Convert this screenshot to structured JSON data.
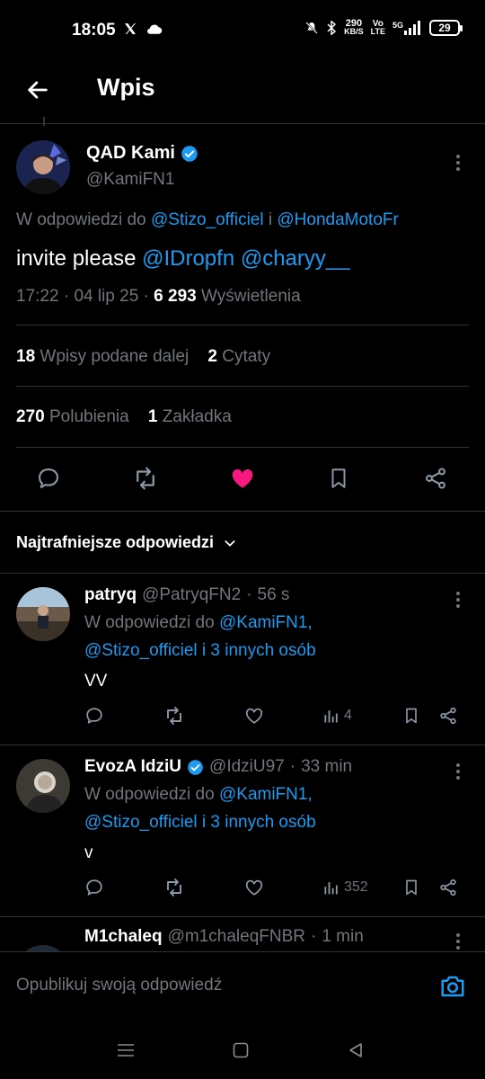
{
  "status_bar": {
    "time": "18:05",
    "net_speed_value": "290",
    "net_speed_unit": "KB/S",
    "volte_top": "Vo",
    "volte_bottom": "LTE",
    "network": "5G",
    "battery": "29"
  },
  "header": {
    "title": "Wpis"
  },
  "tweet": {
    "author_name": "QAD Kami",
    "author_handle": "@KamiFN1",
    "reply_prefix": "W odpowiedzi do",
    "reply_user_1": "@Stizo_officiel",
    "reply_and": "i",
    "reply_user_2": "@HondaMotoFr",
    "text_plain": "invite please",
    "mention_1": "@IDropfn",
    "mention_2": "@charyy__",
    "time": "17:22",
    "date": "04 lip 25",
    "views_count": "6 293",
    "views_label": "Wyświetlenia",
    "retweets_count": "18",
    "retweets_label": "Wpisy podane dalej",
    "quotes_count": "2",
    "quotes_label": "Cytaty",
    "likes_count": "270",
    "likes_label": "Polubienia",
    "bookmarks_count": "1",
    "bookmarks_label": "Zakładka",
    "liked": true,
    "like_color": "#f91880",
    "link_color": "#1d9bf0"
  },
  "sort": {
    "label": "Najtrafniejsze odpowiedzi"
  },
  "replies": [
    {
      "name": "patryq",
      "handle": "@PatryqFN2",
      "age": "56 s",
      "verified": false,
      "reply_prefix": "W odpowiedzi do",
      "reply_user": "@KamiFN1,",
      "reply_line2_user": "@Stizo_officiel",
      "reply_line2_rest": "i 3 innych osób",
      "text": "VV",
      "views": "4"
    },
    {
      "name": "EvozA IdziU",
      "handle": "@IdziU97",
      "age": "33 min",
      "verified": true,
      "reply_prefix": "W odpowiedzi do",
      "reply_user": "@KamiFN1,",
      "reply_line2_user": "@Stizo_officiel",
      "reply_line2_rest": "i 3 innych osób",
      "text": "v",
      "views": "352"
    },
    {
      "name": "M1chaleq",
      "handle": "@m1chaleqFNBR",
      "age": "1 min"
    }
  ],
  "compose": {
    "placeholder": "Opublikuj swoją odpowiedź"
  }
}
